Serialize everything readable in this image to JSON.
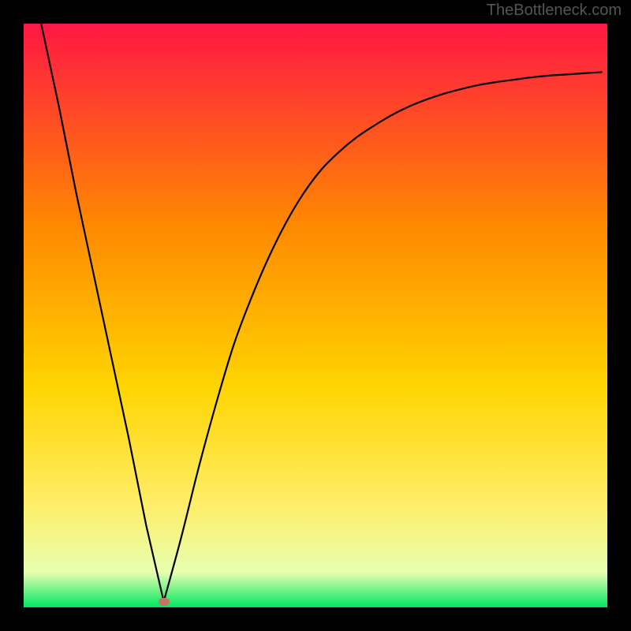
{
  "watermark": "TheBottleneck.com",
  "colors": {
    "bg": "#000000",
    "gradient_top": "#ff1744",
    "gradient_mid1": "#ff8a00",
    "gradient_mid2": "#ffd400",
    "gradient_yellow": "#ffed66",
    "gradient_pale": "#e8ffb0",
    "gradient_bottom": "#00e760",
    "curve": "#000000",
    "marker": "#c67463"
  },
  "chart_data": {
    "type": "line",
    "title": "",
    "xlabel": "",
    "ylabel": "",
    "xlim": [
      0,
      100
    ],
    "ylim": [
      0,
      100
    ],
    "grid": false,
    "legend": false,
    "annotations": [
      {
        "name": "min-marker",
        "x": 24,
        "y": 1
      }
    ],
    "series": [
      {
        "name": "bottleneck-curve",
        "x": [
          3,
          6,
          9,
          12,
          15,
          18,
          21,
          24,
          27,
          30,
          33,
          36,
          39,
          42,
          45,
          48,
          51,
          54,
          57,
          60,
          63,
          66,
          69,
          72,
          75,
          78,
          81,
          84,
          87,
          90,
          93,
          96,
          99
        ],
        "values": [
          100,
          86,
          71,
          57,
          43,
          29,
          14,
          1,
          12,
          24,
          35,
          45,
          53,
          60,
          66,
          71,
          75,
          78,
          80.5,
          82.5,
          84.3,
          85.8,
          87,
          88,
          88.8,
          89.5,
          90,
          90.4,
          90.8,
          91.1,
          91.3,
          91.5,
          91.7
        ]
      }
    ]
  }
}
